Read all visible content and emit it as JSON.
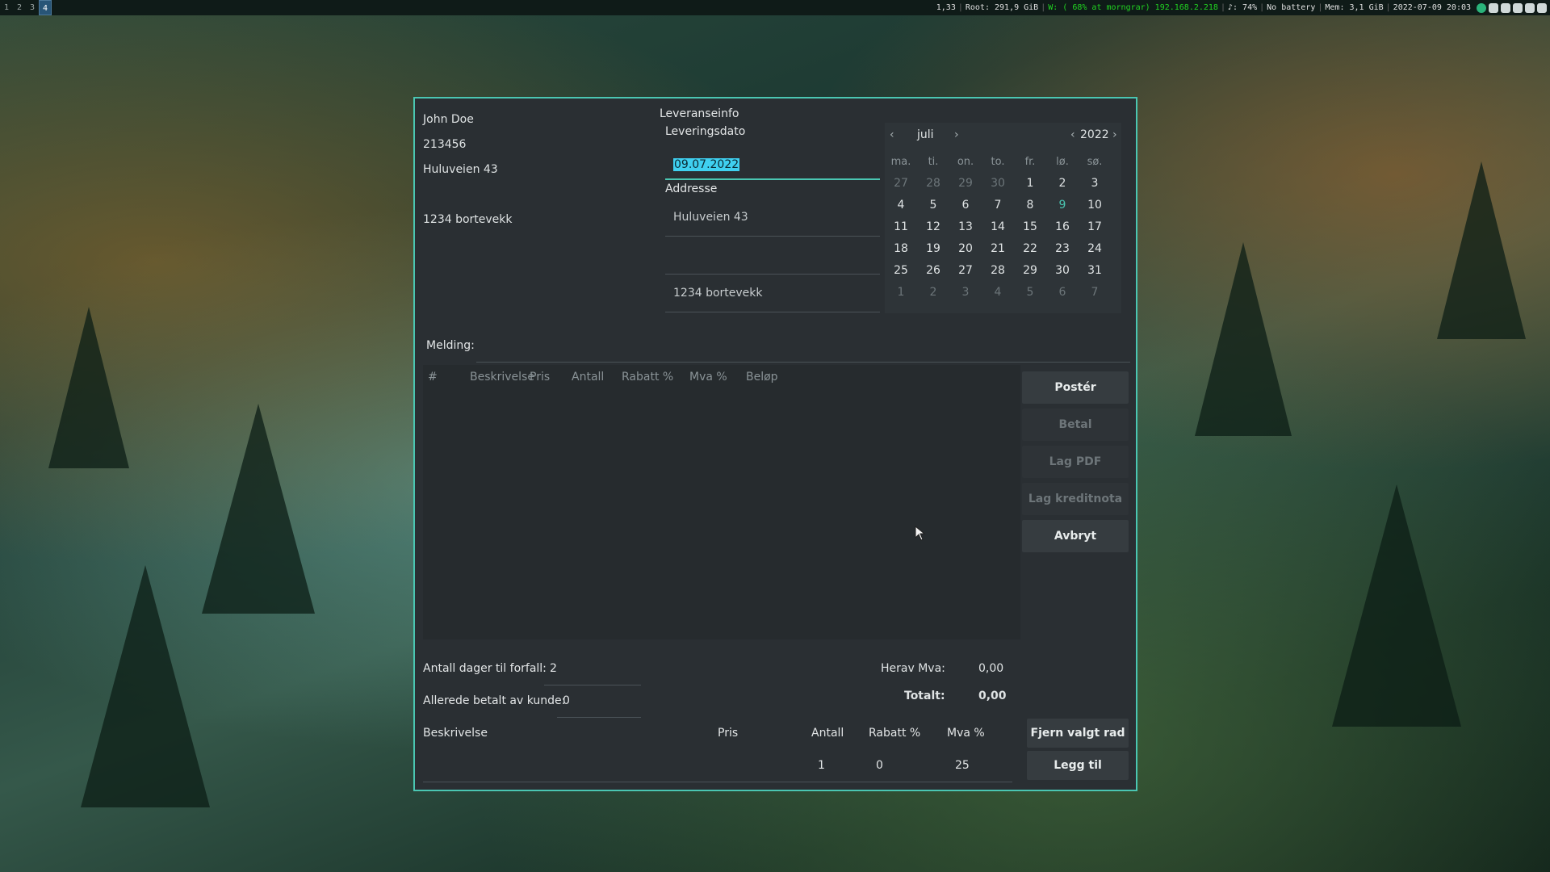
{
  "topbar": {
    "workspaces": [
      "1",
      "2",
      "3",
      "4"
    ],
    "active_workspace": "4",
    "load": "1,33",
    "root": "Root: 291,9 GiB",
    "wifi": "W: ( 68% at morngrar) 192.168.2.218",
    "volume": "♪: 74%",
    "battery": "No battery",
    "mem": "Mem: 3,1 GiB",
    "datetime": "2022-07-09 20:03"
  },
  "customer": {
    "name": "John Doe",
    "number": "213456",
    "address": "Huluveien 43",
    "postal": "1234 bortevekk"
  },
  "delivery": {
    "section_title": "Leveranseinfo",
    "date_label": "Leveringsdato",
    "date_value": "09.07.2022",
    "address_label": "Addresse",
    "address_line1": "Huluveien 43",
    "address_line2": "",
    "address_line3": "1234 bortevekk"
  },
  "calendar": {
    "month": "juli",
    "year": "2022",
    "weekdays": [
      "ma.",
      "ti.",
      "on.",
      "to.",
      "fr.",
      "lø.",
      "sø."
    ],
    "weeks": [
      [
        "27",
        "28",
        "29",
        "30",
        "1",
        "2",
        "3"
      ],
      [
        "4",
        "5",
        "6",
        "7",
        "8",
        "9",
        "10"
      ],
      [
        "11",
        "12",
        "13",
        "14",
        "15",
        "16",
        "17"
      ],
      [
        "18",
        "19",
        "20",
        "21",
        "22",
        "23",
        "24"
      ],
      [
        "25",
        "26",
        "27",
        "28",
        "29",
        "30",
        "31"
      ],
      [
        "1",
        "2",
        "3",
        "4",
        "5",
        "6",
        "7"
      ]
    ],
    "selected_day": "9",
    "accent": "#4ac6b2"
  },
  "message_label": "Melding:",
  "items_table": {
    "columns": [
      "#",
      "Beskrivelse",
      "Pris",
      "Antall",
      "Rabatt %",
      "Mva %",
      "Beløp"
    ],
    "rows": []
  },
  "actions": {
    "post": "Postér",
    "pay": "Betal",
    "pdf": "Lag PDF",
    "credit": "Lag kreditnota",
    "cancel": "Avbryt"
  },
  "footer": {
    "due_days_label": "Antall dager til forfall:",
    "due_days_value": "2",
    "paid_label": "Allerede betalt av kunde:",
    "paid_value": "0",
    "vat_label": "Herav Mva:",
    "vat_value": "0,00",
    "total_label": "Totalt:",
    "total_value": "0,00"
  },
  "new_line": {
    "headers": [
      "Beskrivelse",
      "Pris",
      "Antall",
      "Rabatt %",
      "Mva %"
    ],
    "description": "",
    "price": "",
    "quantity": "1",
    "discount": "0",
    "vat": "25",
    "remove_button": "Fjern valgt rad",
    "add_button": "Legg til"
  }
}
